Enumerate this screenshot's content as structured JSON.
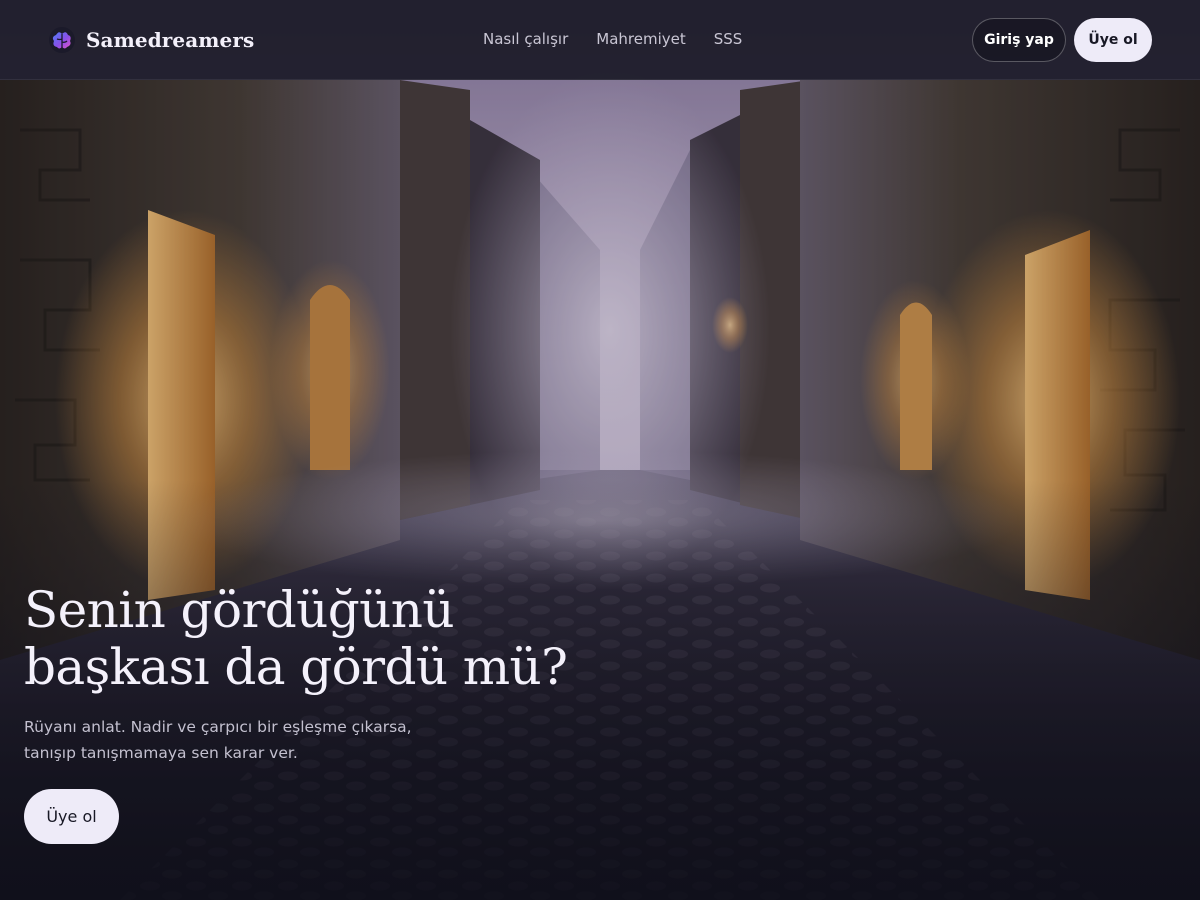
{
  "brand": {
    "name": "Samedreamers",
    "logo_icon": "brain-icon",
    "accent": "#7b5cf0"
  },
  "nav": {
    "links": [
      {
        "label": "Nasıl çalışır"
      },
      {
        "label": "Mahremiyet"
      },
      {
        "label": "SSS"
      }
    ]
  },
  "auth": {
    "login_label": "Giriş yap",
    "signup_label": "Üye ol"
  },
  "hero": {
    "title_lines": [
      "Senin gördüğünü",
      "başkası da gördü mü?"
    ],
    "subtitle_lines": [
      "Rüyanı anlat. Nadir ve çarpıcı bir eşleşme çıkarsa,",
      "tanışıp tanışmamaya sen karar ver."
    ],
    "cta_label": "Üye ol",
    "background": "misty-cobblestone-alley-image"
  },
  "colors": {
    "page_bg": "#12121d",
    "button_light": "#eeebf8",
    "text_primary": "#f4f1fb",
    "text_muted": "#c3c0cf",
    "window_glow": "#f0b468",
    "fog": "#b8a8cc"
  }
}
